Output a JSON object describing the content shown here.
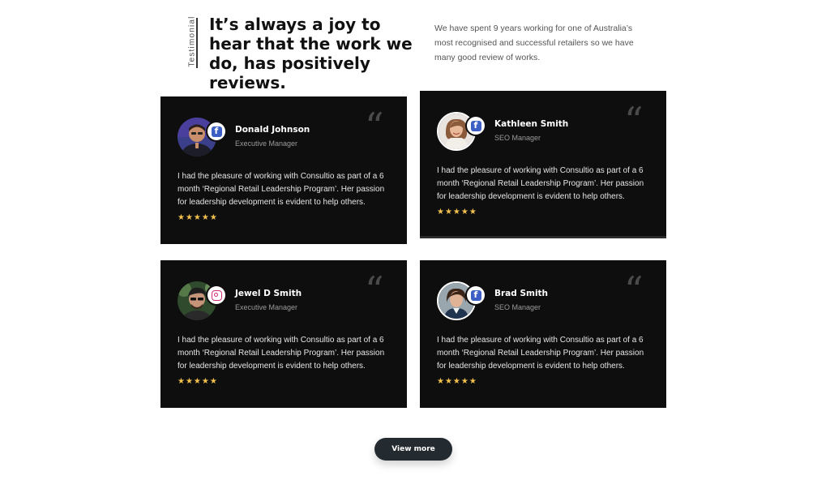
{
  "header": {
    "tag": "Testimonial",
    "heading": "It’s always a joy to hear that the work we do, has positively reviews.",
    "intro": "We have spent 9 years working for one of Australia’s most recognised and successful retailers so we have many good review of works."
  },
  "testimonials": [
    {
      "name": "Donald Johnson",
      "role": "Executive Manager",
      "network": "facebook-icon",
      "text": "I had the pleasure of working with Consultio as part of a 6 month ‘Regional Retail Leadership Program’. Her passion for leadership development is evident to help others.",
      "rating": 5,
      "stars": "★★★★★"
    },
    {
      "name": "Kathleen Smith",
      "role": "SEO Manager",
      "network": "facebook-icon",
      "text": "I had the pleasure of working with Consultio as part of a 6 month ‘Regional Retail Leadership Program’. Her passion for leadership development is evident to help others.",
      "rating": 5,
      "stars": "★★★★★"
    },
    {
      "name": "Jewel D Smith",
      "role": "Executive Manager",
      "network": "instagram-icon",
      "text": "I had the pleasure of working with Consultio as part of a 6 month ‘Regional Retail Leadership Program’. Her passion for leadership development is evident to help others.",
      "rating": 5,
      "stars": "★★★★★"
    },
    {
      "name": "Brad Smith",
      "role": "SEO Manager",
      "network": "facebook-icon",
      "text": "I had the pleasure of working with Consultio as part of a 6 month ‘Regional Retail Leadership Program’. Her passion for leadership development is evident to help others.",
      "rating": 5,
      "stars": "★★★★★"
    }
  ],
  "quote_mark": "“",
  "view_more": "View more",
  "colors": {
    "card_bg": "#0e0e0e",
    "star": "#f2c14e",
    "button_bg": "#232a30",
    "facebook": "#3b5fc4",
    "instagram": "#d62976"
  }
}
